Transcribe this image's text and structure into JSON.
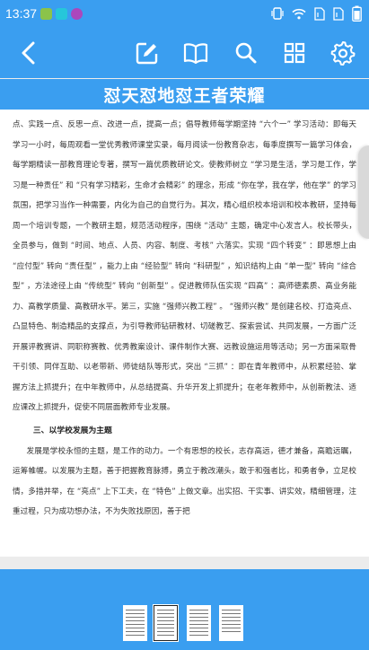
{
  "status_bar": {
    "time": "13:37",
    "battery": "battery-icon",
    "colors": {
      "bar": "#3a9ef0",
      "notif1": "#8bc34a",
      "notif2": "#26c6da",
      "notif3": "#ab47bc"
    }
  },
  "toolbar": {
    "icons": [
      "back-arrow-icon",
      "edit-icon",
      "book-icon",
      "search-icon",
      "grid-icon",
      "gear-icon"
    ]
  },
  "document": {
    "title": "怼天怼地怼王者荣耀",
    "paragraphs": [
      "点、实践一点、反思一点、改进一点，提高一点；倡导教师每学期坚持 “六个一” 学习活动：即每天学习一小时，每周观看一堂优秀教师课堂实录，每月阅读一份教育杂志，每季度撰写一篇学习体会，每学期精读一部教育理论专著，撰写一篇优质教研论文。使教师树立 “学习是生活，学习是工作，学习是一种责任” 和 “只有学习精彩，生命才会精彩” 的理念，形成 “你在学，我在学，他在学” 的学习氛围，把学习当作一种需要，内化为自己的自觉行为。其次，精心组织校本培训和校本教研，坚持每周一个培训专题，一个教研主题，规范活动程序，围绕 “活动” 主题，确定中心发言人。校长带头，全员参与，做到 “时间、地点、人员、内容、制度、考核” 六落实。实现 “四个转变” ：即思想上由 “应付型” 转向 “责任型” ，能力上由 “经验型” 转向 “科研型” ，知识结构上由 “单一型” 转向 “综合型” ，方法途径上由 “传统型” 转向 “创新型” 。促进教师队伍实现 “四高” ：高师德素质、高业务能力、高教学质量、高教研水平。第三，实施 “强师兴教工程” 。 “强师兴教” 是创建名校、打造亮点、凸显特色、制造精品的支撑点，为引导教师钻研教材、切磋教艺、探索尝试、共同发展，一方面广泛开展评教赛讲、同职称赛教、优秀教案设计、课件制作大赛、远教设施运用等活动；另一方面采取骨干引领、同伴互助、以老带新、师徒结队等形式，突出 “三抓” ：即在青年教师中，从积累经验、掌握方法上抓提升；在中年教师中，从总结提高、升华开发上抓提升；在老年教师中，从创新教法、适应课改上抓提升，促使不同层面教师专业发展。"
    ],
    "section_heading": "三、以学校发展为主题",
    "section_paragraph": "发展是学校永恒的主题，是工作的动力。一个有思想的校长，志存高远，德才兼备，高瞻远瞩，运筹帷幄。以发展为主题，善于把握教育脉搏，勇立于教改潮头，敢于和强者比，和勇者争，立足校情，多措并举，在 “亮点” 上下工夫，在 “特色” 上做文章。出实招、干实事、讲实效，精细管理，注重过程，只为成功想办法，不为失败找原因，善于把"
  },
  "thumbnails": {
    "count": 4,
    "selected_index": 1
  }
}
